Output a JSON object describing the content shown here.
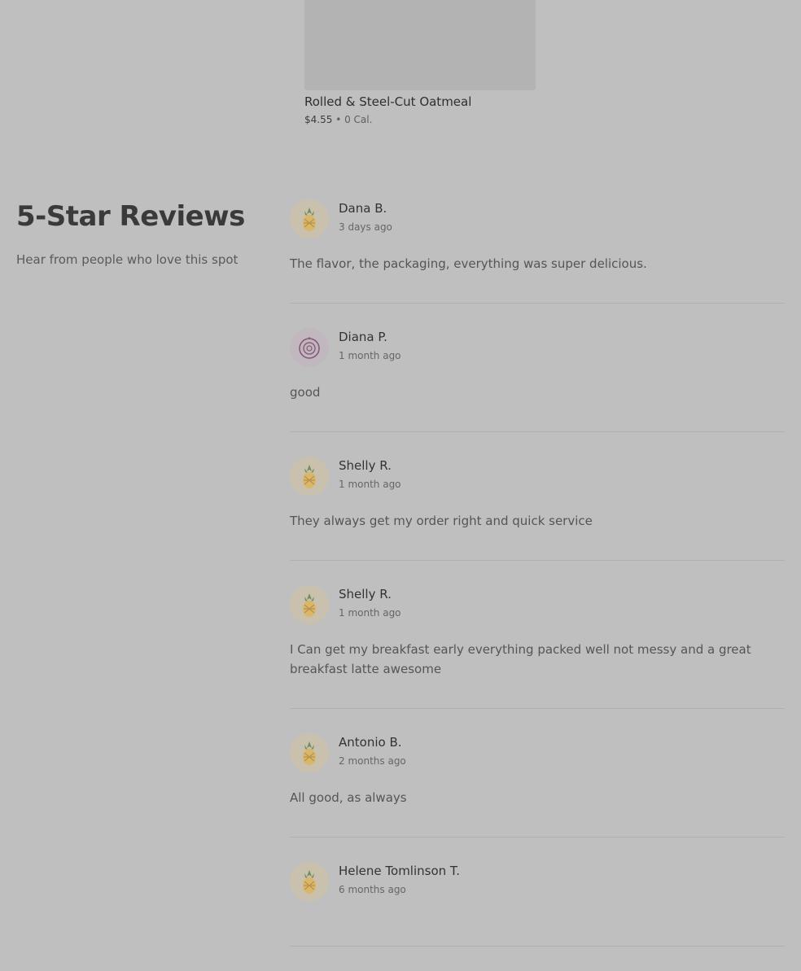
{
  "product": {
    "name": "Rolled & Steel-Cut Oatmeal",
    "price": "$4.55",
    "separator": "•",
    "calories": "0 Cal."
  },
  "reviews_section": {
    "title": "5-Star Reviews",
    "subtitle": "Hear from people who love this spot"
  },
  "reviews": [
    {
      "name": "Dana B.",
      "date": "3 days ago",
      "text": "The flavor, the packaging, everything was super delicious.",
      "avatar": "pineapple-icon"
    },
    {
      "name": "Diana P.",
      "date": "1 month ago",
      "text": "good",
      "avatar": "onion-icon"
    },
    {
      "name": "Shelly R.",
      "date": "1 month ago",
      "text": "They always get my order right and quick service",
      "avatar": "pineapple-icon"
    },
    {
      "name": "Shelly R.",
      "date": "1 month ago",
      "text": "I Can get my breakfast early everything packed well not messy and a great breakfast latte awesome",
      "avatar": "pineapple-icon"
    },
    {
      "name": "Antonio B.",
      "date": "2 months ago",
      "text": "All good, as always",
      "avatar": "pineapple-icon"
    },
    {
      "name": "Helene Tomlinson T.",
      "date": "6 months ago",
      "text": "",
      "avatar": "pineapple-icon"
    }
  ],
  "colors": {
    "background": "#bfbfbf",
    "avatar_pineapple_bg": "#c9c1ae",
    "avatar_onion_bg": "#c1b8bf"
  }
}
